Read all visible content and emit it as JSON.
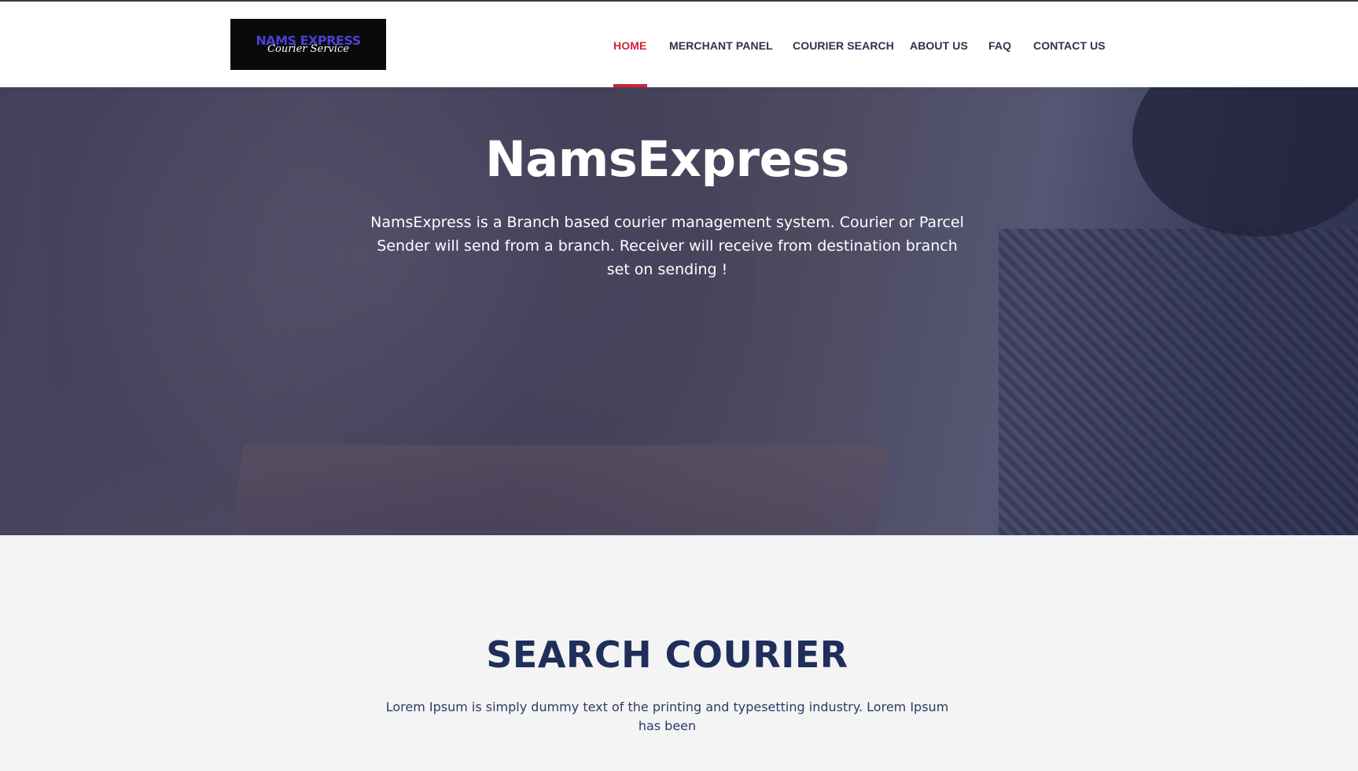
{
  "logo": {
    "main": "NAMS EXPRESS",
    "sub": "Courier Service"
  },
  "nav": {
    "items": [
      {
        "label": "HOME",
        "active": true
      },
      {
        "label": "MERCHANT PANEL",
        "active": false
      },
      {
        "label": "COURIER SEARCH",
        "active": false
      },
      {
        "label": "ABOUT US",
        "active": false
      },
      {
        "label": "FAQ",
        "active": false
      },
      {
        "label": "CONTACT US",
        "active": false
      }
    ]
  },
  "hero": {
    "title": "NamsExpress",
    "description": "NamsExpress is a Branch based courier management system. Courier or Parcel Sender will send from a branch. Receiver will receive from destination branch set on sending !"
  },
  "search": {
    "title": "SEARCH COURIER",
    "description": "Lorem Ipsum is simply dummy text of the printing and typesetting industry. Lorem Ipsum has been"
  },
  "colors": {
    "accent": "#d22236",
    "nav_text": "#2d3350",
    "heading": "#1f2e5a",
    "logo_blue": "#4b3fd8"
  }
}
